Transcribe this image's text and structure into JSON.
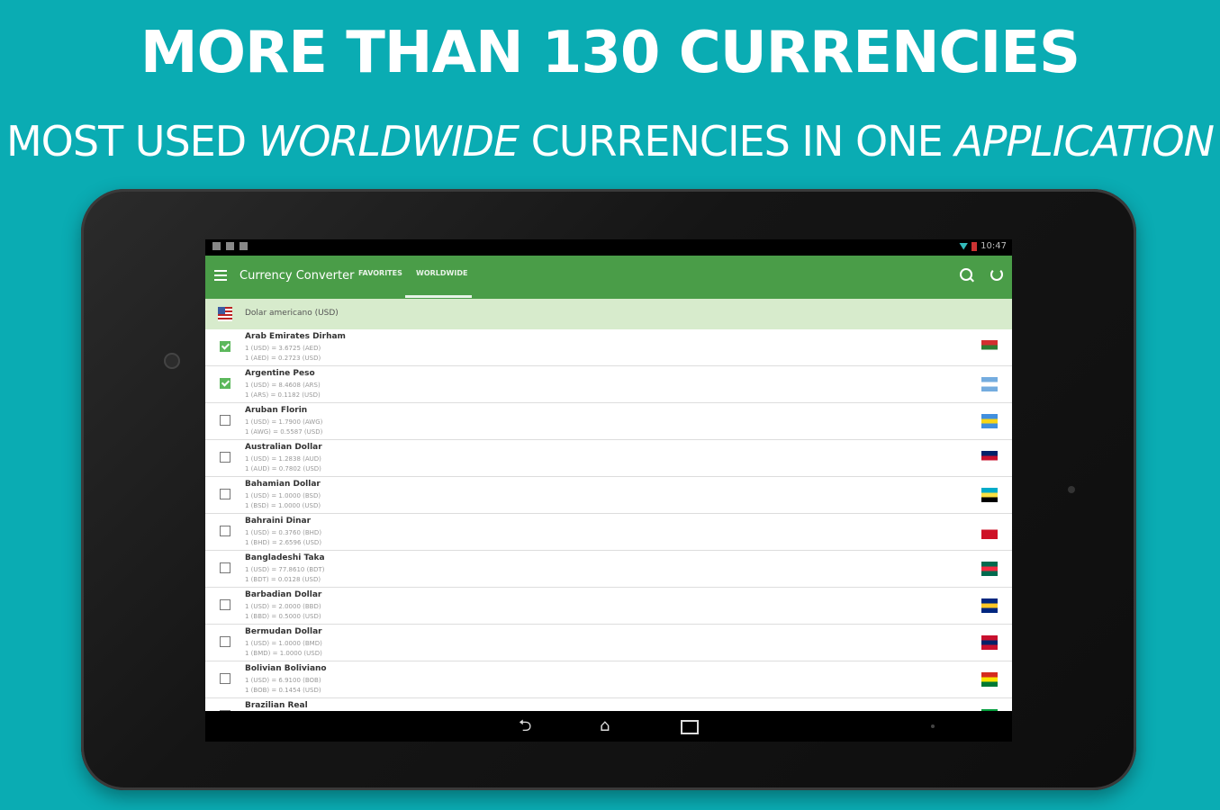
{
  "promo": {
    "headline": "MORE THAN 130 CURRENCIES",
    "sub_part1": "MOST USED ",
    "sub_italic1": "WORLDWIDE",
    "sub_part2": " CURRENCIES IN ONE ",
    "sub_italic2": "APPLICATION"
  },
  "status": {
    "time": "10:47"
  },
  "appbar": {
    "title": "Currency Converter",
    "tabs": [
      "FAVORITES",
      "WORLDWIDE"
    ],
    "active_tab": "WORLDWIDE",
    "color": "#4a9d48"
  },
  "base": {
    "label": "Dolar americano (USD)"
  },
  "currencies": [
    {
      "name": "Arab Emirates Dirham",
      "r1": "1 (USD) = 3.6725 (AED)",
      "r2": "1 (AED) = 0.2723 (USD)",
      "checked": true,
      "flag": [
        "#d32f2f",
        "#2e7d32",
        "#fff",
        "#000"
      ]
    },
    {
      "name": "Argentine Peso",
      "r1": "1 (USD) = 8.4608 (ARS)",
      "r2": "1 (ARS) = 0.1182 (USD)",
      "checked": true,
      "flag": [
        "#74acdf",
        "#fff",
        "#74acdf"
      ]
    },
    {
      "name": "Aruban Florin",
      "r1": "1 (USD) = 1.7900 (AWG)",
      "r2": "1 (AWG) = 0.5587 (USD)",
      "checked": false,
      "flag": [
        "#418fde",
        "#f9d616",
        "#418fde"
      ]
    },
    {
      "name": "Australian Dollar",
      "r1": "1 (USD) = 1.2838 (AUD)",
      "r2": "1 (AUD) = 0.7802 (USD)",
      "checked": false,
      "flag": [
        "#012169",
        "#c8102e",
        "#fff"
      ]
    },
    {
      "name": "Bahamian Dollar",
      "r1": "1 (USD) = 1.0000 (BSD)",
      "r2": "1 (BSD) = 1.0000 (USD)",
      "checked": false,
      "flag": [
        "#00abc9",
        "#fae042",
        "#000"
      ]
    },
    {
      "name": "Bahraini Dinar",
      "r1": "1 (USD) = 0.3760 (BHD)",
      "r2": "1 (BHD) = 2.6596 (USD)",
      "checked": false,
      "flag": [
        "#fff",
        "#ce1126",
        "#ce1126"
      ]
    },
    {
      "name": "Bangladeshi Taka",
      "r1": "1 (USD) = 77.8610 (BDT)",
      "r2": "1 (BDT) = 0.0128 (USD)",
      "checked": false,
      "flag": [
        "#006a4e",
        "#f42a41",
        "#006a4e"
      ]
    },
    {
      "name": "Barbadian Dollar",
      "r1": "1 (USD) = 2.0000 (BBD)",
      "r2": "1 (BBD) = 0.5000 (USD)",
      "checked": false,
      "flag": [
        "#00267f",
        "#ffc726",
        "#00267f"
      ]
    },
    {
      "name": "Bermudan Dollar",
      "r1": "1 (USD) = 1.0000 (BMD)",
      "r2": "1 (BMD) = 1.0000 (USD)",
      "checked": false,
      "flag": [
        "#c8102e",
        "#012169",
        "#c8102e"
      ]
    },
    {
      "name": "Bolivian Boliviano",
      "r1": "1 (USD) = 6.9100 (BOB)",
      "r2": "1 (BOB) = 0.1454 (USD)",
      "checked": false,
      "flag": [
        "#d52b1e",
        "#f9e300",
        "#007934"
      ]
    },
    {
      "name": "Brazilian Real",
      "r1": "",
      "r2": "",
      "checked": false,
      "flag": [
        "#009c3b",
        "#ffdf00",
        "#009c3b"
      ]
    }
  ],
  "nav": {
    "back": "⮌",
    "home": "⌂"
  }
}
